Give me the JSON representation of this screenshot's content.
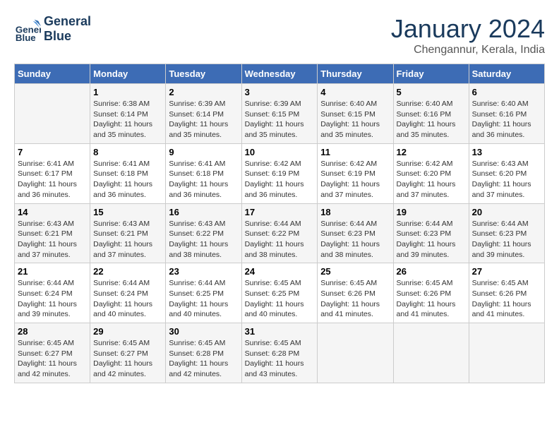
{
  "header": {
    "logo_line1": "General",
    "logo_line2": "Blue",
    "month": "January 2024",
    "location": "Chengannur, Kerala, India"
  },
  "columns": [
    "Sunday",
    "Monday",
    "Tuesday",
    "Wednesday",
    "Thursday",
    "Friday",
    "Saturday"
  ],
  "weeks": [
    [
      {
        "day": "",
        "sunrise": "",
        "sunset": "",
        "daylight": ""
      },
      {
        "day": "1",
        "sunrise": "6:38 AM",
        "sunset": "6:14 PM",
        "daylight": "11 hours and 35 minutes."
      },
      {
        "day": "2",
        "sunrise": "6:39 AM",
        "sunset": "6:14 PM",
        "daylight": "11 hours and 35 minutes."
      },
      {
        "day": "3",
        "sunrise": "6:39 AM",
        "sunset": "6:15 PM",
        "daylight": "11 hours and 35 minutes."
      },
      {
        "day": "4",
        "sunrise": "6:40 AM",
        "sunset": "6:15 PM",
        "daylight": "11 hours and 35 minutes."
      },
      {
        "day": "5",
        "sunrise": "6:40 AM",
        "sunset": "6:16 PM",
        "daylight": "11 hours and 35 minutes."
      },
      {
        "day": "6",
        "sunrise": "6:40 AM",
        "sunset": "6:16 PM",
        "daylight": "11 hours and 36 minutes."
      }
    ],
    [
      {
        "day": "7",
        "sunrise": "6:41 AM",
        "sunset": "6:17 PM",
        "daylight": "11 hours and 36 minutes."
      },
      {
        "day": "8",
        "sunrise": "6:41 AM",
        "sunset": "6:18 PM",
        "daylight": "11 hours and 36 minutes."
      },
      {
        "day": "9",
        "sunrise": "6:41 AM",
        "sunset": "6:18 PM",
        "daylight": "11 hours and 36 minutes."
      },
      {
        "day": "10",
        "sunrise": "6:42 AM",
        "sunset": "6:19 PM",
        "daylight": "11 hours and 36 minutes."
      },
      {
        "day": "11",
        "sunrise": "6:42 AM",
        "sunset": "6:19 PM",
        "daylight": "11 hours and 37 minutes."
      },
      {
        "day": "12",
        "sunrise": "6:42 AM",
        "sunset": "6:20 PM",
        "daylight": "11 hours and 37 minutes."
      },
      {
        "day": "13",
        "sunrise": "6:43 AM",
        "sunset": "6:20 PM",
        "daylight": "11 hours and 37 minutes."
      }
    ],
    [
      {
        "day": "14",
        "sunrise": "6:43 AM",
        "sunset": "6:21 PM",
        "daylight": "11 hours and 37 minutes."
      },
      {
        "day": "15",
        "sunrise": "6:43 AM",
        "sunset": "6:21 PM",
        "daylight": "11 hours and 37 minutes."
      },
      {
        "day": "16",
        "sunrise": "6:43 AM",
        "sunset": "6:22 PM",
        "daylight": "11 hours and 38 minutes."
      },
      {
        "day": "17",
        "sunrise": "6:44 AM",
        "sunset": "6:22 PM",
        "daylight": "11 hours and 38 minutes."
      },
      {
        "day": "18",
        "sunrise": "6:44 AM",
        "sunset": "6:23 PM",
        "daylight": "11 hours and 38 minutes."
      },
      {
        "day": "19",
        "sunrise": "6:44 AM",
        "sunset": "6:23 PM",
        "daylight": "11 hours and 39 minutes."
      },
      {
        "day": "20",
        "sunrise": "6:44 AM",
        "sunset": "6:23 PM",
        "daylight": "11 hours and 39 minutes."
      }
    ],
    [
      {
        "day": "21",
        "sunrise": "6:44 AM",
        "sunset": "6:24 PM",
        "daylight": "11 hours and 39 minutes."
      },
      {
        "day": "22",
        "sunrise": "6:44 AM",
        "sunset": "6:24 PM",
        "daylight": "11 hours and 40 minutes."
      },
      {
        "day": "23",
        "sunrise": "6:44 AM",
        "sunset": "6:25 PM",
        "daylight": "11 hours and 40 minutes."
      },
      {
        "day": "24",
        "sunrise": "6:45 AM",
        "sunset": "6:25 PM",
        "daylight": "11 hours and 40 minutes."
      },
      {
        "day": "25",
        "sunrise": "6:45 AM",
        "sunset": "6:26 PM",
        "daylight": "11 hours and 41 minutes."
      },
      {
        "day": "26",
        "sunrise": "6:45 AM",
        "sunset": "6:26 PM",
        "daylight": "11 hours and 41 minutes."
      },
      {
        "day": "27",
        "sunrise": "6:45 AM",
        "sunset": "6:26 PM",
        "daylight": "11 hours and 41 minutes."
      }
    ],
    [
      {
        "day": "28",
        "sunrise": "6:45 AM",
        "sunset": "6:27 PM",
        "daylight": "11 hours and 42 minutes."
      },
      {
        "day": "29",
        "sunrise": "6:45 AM",
        "sunset": "6:27 PM",
        "daylight": "11 hours and 42 minutes."
      },
      {
        "day": "30",
        "sunrise": "6:45 AM",
        "sunset": "6:28 PM",
        "daylight": "11 hours and 42 minutes."
      },
      {
        "day": "31",
        "sunrise": "6:45 AM",
        "sunset": "6:28 PM",
        "daylight": "11 hours and 43 minutes."
      },
      {
        "day": "",
        "sunrise": "",
        "sunset": "",
        "daylight": ""
      },
      {
        "day": "",
        "sunrise": "",
        "sunset": "",
        "daylight": ""
      },
      {
        "day": "",
        "sunrise": "",
        "sunset": "",
        "daylight": ""
      }
    ]
  ]
}
